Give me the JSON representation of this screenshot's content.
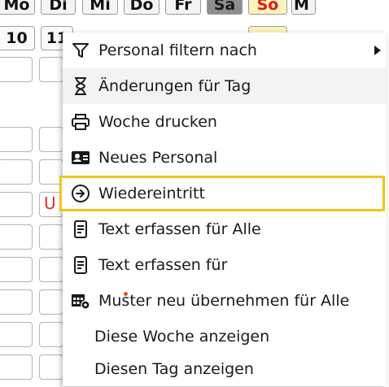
{
  "calendar": {
    "weekdays": [
      "Mo",
      "Di",
      "Mi",
      "Do",
      "Fr",
      "Sa",
      "So",
      "M"
    ],
    "dates": [
      "10",
      "11"
    ],
    "absence_code": "U"
  },
  "context_menu": {
    "items": [
      {
        "label": "Personal filtern nach",
        "icon": "filter-icon",
        "has_submenu": true
      },
      {
        "label": "Änderungen für Tag",
        "icon": "hourglass-icon"
      },
      {
        "label": "Woche drucken",
        "icon": "printer-icon"
      },
      {
        "label": "Neues Personal",
        "icon": "id-card-icon"
      },
      {
        "label": "Wiedereintritt",
        "icon": "arrow-circle-right-icon",
        "highlighted": true
      },
      {
        "label": "Text erfassen für Alle",
        "icon": "document-icon"
      },
      {
        "label": "Text erfassen für",
        "icon": "document-icon"
      },
      {
        "label": "Muster neu übernehmen für Alle",
        "icon": "calendar-pattern-icon"
      },
      {
        "label": "Diese Woche anzeigen",
        "icon": ""
      },
      {
        "label": "Diesen Tag anzeigen",
        "icon": ""
      }
    ]
  },
  "colors": {
    "highlight_border": "#f5c518",
    "sunday_text": "#e01b1b",
    "sunday_background": "#fbf3b8",
    "saturday_background": "#8e8e8e"
  }
}
